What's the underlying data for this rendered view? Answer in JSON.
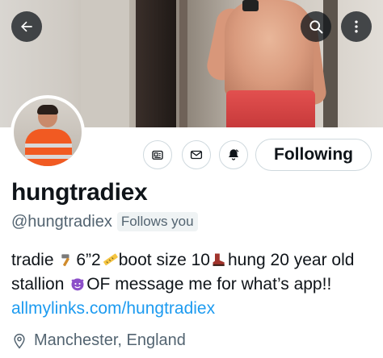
{
  "banner": {
    "description_icon": "banner-photo"
  },
  "top_bar": {
    "back_icon": "arrow-left-icon",
    "search_icon": "search-icon",
    "more_icon": "more-vertical-icon"
  },
  "actions": {
    "notifications_icon": "bell-icon",
    "following_label": "Following"
  },
  "profile": {
    "name": "hungtradiex",
    "handle": "@hungtradiex",
    "follows_you": "Follows you",
    "bio": {
      "part1": "tradie ",
      "part2": "6”2",
      "part3": "boot size 10",
      "part4": "hung 20 year old stallion ",
      "part5": "OF message me for what’s app!! ",
      "link": "allmylinks.com/hungtradiex"
    },
    "location": "Manchester, England"
  },
  "colors": {
    "link": "#1d9bf0",
    "secondary_text": "#536471",
    "border": "#cfd9de"
  }
}
